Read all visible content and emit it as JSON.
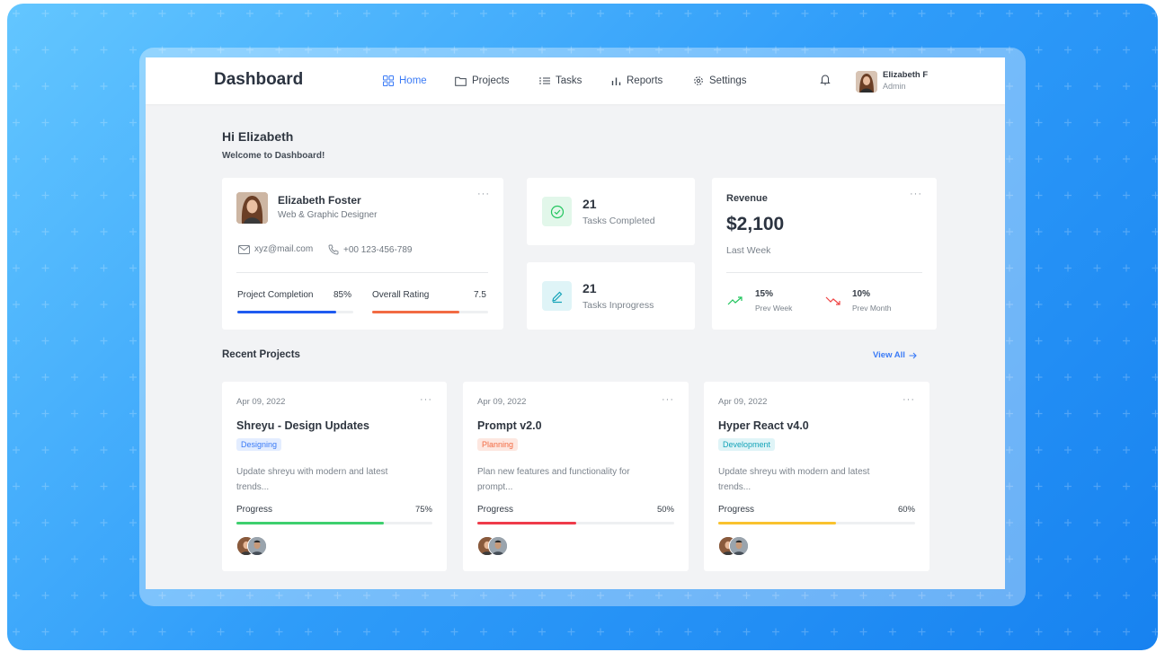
{
  "header": {
    "brand": "Dashboard",
    "nav": [
      {
        "label": "Home",
        "icon": "grid-icon",
        "active": true
      },
      {
        "label": "Projects",
        "icon": "folder-icon"
      },
      {
        "label": "Tasks",
        "icon": "list-icon"
      },
      {
        "label": "Reports",
        "icon": "bar-chart-icon"
      },
      {
        "label": "Settings",
        "icon": "gear-icon"
      }
    ],
    "user": {
      "name": "Elizabeth F",
      "role": "Admin"
    }
  },
  "greeting": {
    "title": "Hi Elizabeth",
    "subtitle": "Welcome to Dashboard!"
  },
  "profile": {
    "name": "Elizabeth Foster",
    "title": "Web & Graphic Designer",
    "email": "xyz@mail.com",
    "phone": "+00 123-456-789",
    "metrics": [
      {
        "label": "Project Completion",
        "value": "85%",
        "progress": 0.85,
        "color": "#1f5bf0"
      },
      {
        "label": "Overall Rating",
        "value": "7.5",
        "progress": 0.75,
        "color": "#f26b43"
      }
    ]
  },
  "tasks": [
    {
      "count": "21",
      "label": "Tasks Completed",
      "icon": "check-circle-icon",
      "color": "#22c55e"
    },
    {
      "count": "21",
      "label": "Tasks Inprogress",
      "icon": "pencil-icon",
      "color": "#14a3b8"
    }
  ],
  "revenue": {
    "title": "Revenue",
    "amount": "$2,100",
    "period": "Last Week",
    "stats": [
      {
        "value": "15%",
        "label": "Prev Week",
        "trend": "up",
        "color": "#22c55e"
      },
      {
        "value": "10%",
        "label": "Prev Month",
        "trend": "down",
        "color": "#ef4444"
      }
    ]
  },
  "recent": {
    "title": "Recent Projects",
    "view_all": "View All"
  },
  "projects": [
    {
      "date": "Apr 09, 2022",
      "title": "Shreyu - Design Updates",
      "badge": "Designing",
      "badge_color": "#3b7bf6",
      "badge_bg": "#e3edff",
      "desc": "Update shreyu with modern and latest trends...",
      "progress_label": "Progress",
      "progress": "75%",
      "fill": 0.75,
      "color": "#3ecf6e"
    },
    {
      "date": "Apr 09, 2022",
      "title": "Prompt v2.0",
      "badge": "Planning",
      "badge_color": "#f26b43",
      "badge_bg": "#fde7e0",
      "desc": "Plan new features and functionality for prompt...",
      "progress_label": "Progress",
      "progress": "50%",
      "fill": 0.5,
      "color": "#ef3b4a"
    },
    {
      "date": "Apr 09, 2022",
      "title": "Hyper React v4.0",
      "badge": "Development",
      "badge_color": "#14a3b8",
      "badge_bg": "#dff4f7",
      "desc": "Update shreyu with modern and latest trends...",
      "progress_label": "Progress",
      "progress": "60%",
      "fill": 0.6,
      "color": "#f9c22e"
    }
  ]
}
